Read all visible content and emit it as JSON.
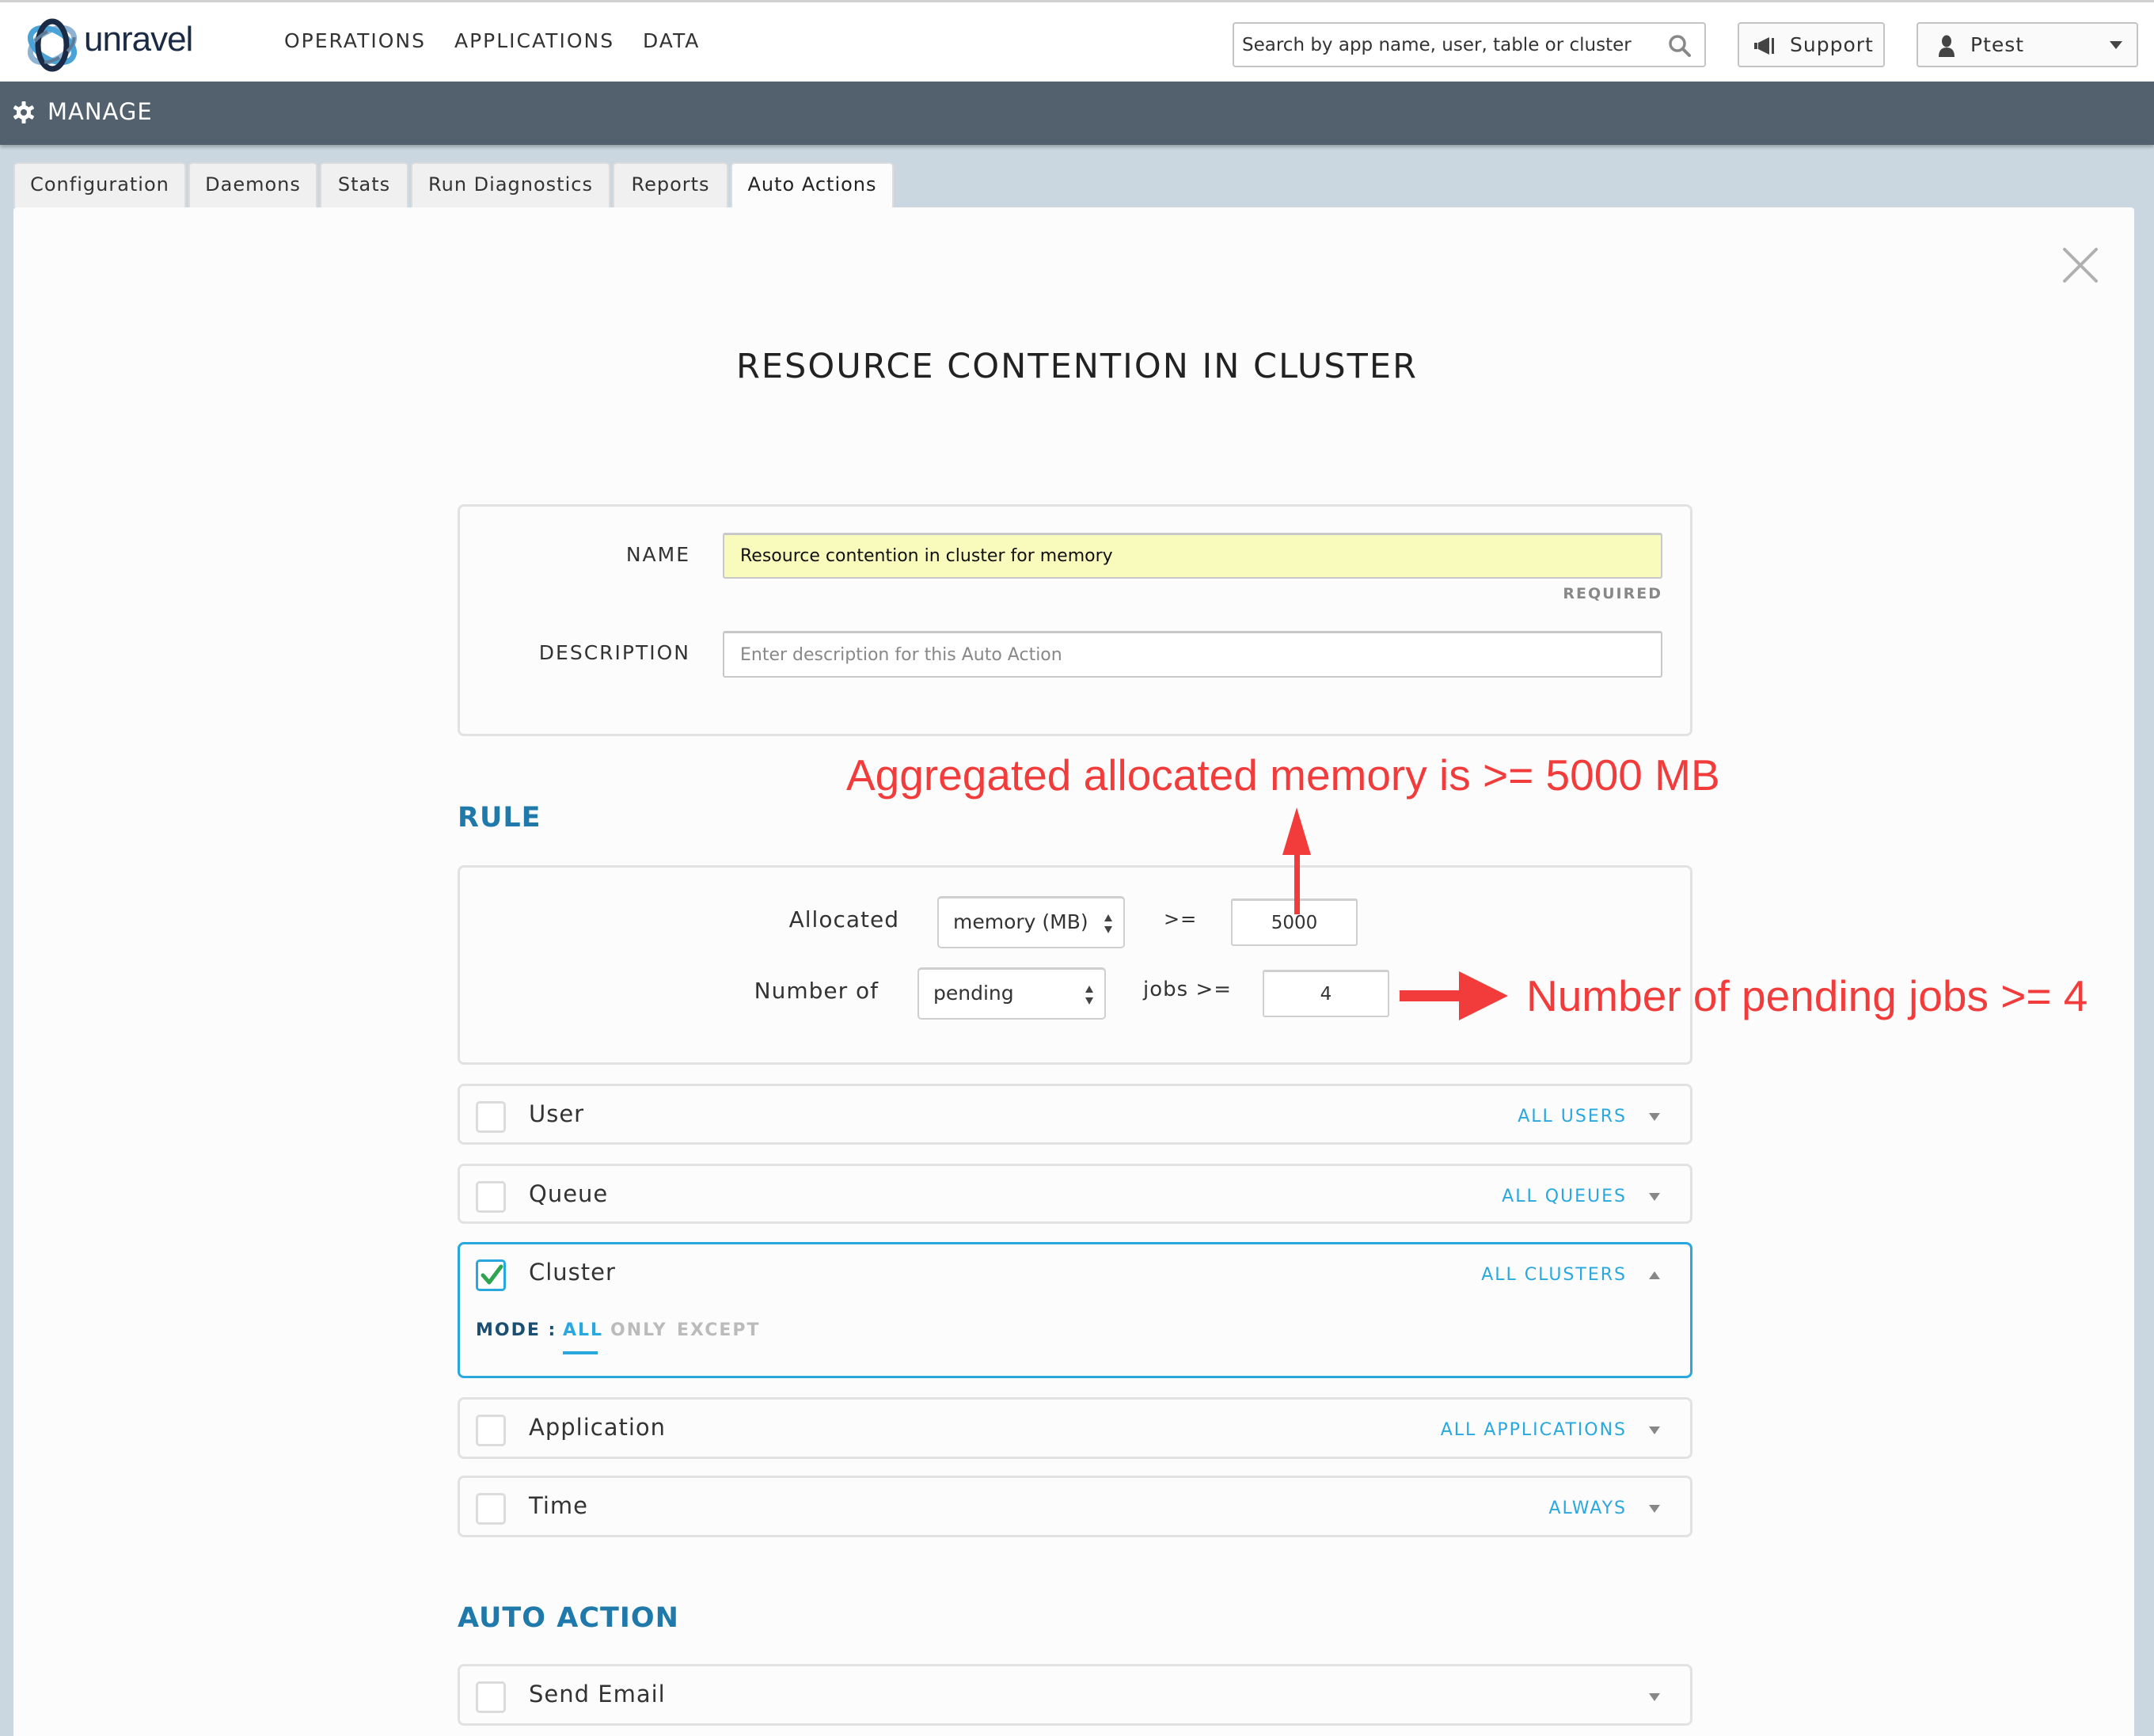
{
  "header": {
    "brand": "unravel",
    "nav": [
      "OPERATIONS",
      "APPLICATIONS",
      "DATA"
    ],
    "search_placeholder": "Search by app name, user, table or cluster",
    "support_label": "Support",
    "user_label": "Ptest",
    "icons": {
      "logo": "unravel-logo",
      "search": "search-icon",
      "support": "megaphone-icon",
      "user": "user-icon",
      "menu": "caret-down-icon"
    }
  },
  "manage_bar": {
    "title": "MANAGE",
    "icon": "gear-icon"
  },
  "tabs": [
    {
      "label": "Configuration",
      "active": false
    },
    {
      "label": "Daemons",
      "active": false
    },
    {
      "label": "Stats",
      "active": false
    },
    {
      "label": "Run Diagnostics",
      "active": false
    },
    {
      "label": "Reports",
      "active": false
    },
    {
      "label": "Auto Actions",
      "active": true
    }
  ],
  "page": {
    "title": "RESOURCE CONTENTION IN CLUSTER",
    "close_icon": "close-icon"
  },
  "form": {
    "name_label": "NAME",
    "name_value": "Resource contention in cluster for memory",
    "required_label": "REQUIRED",
    "description_label": "DESCRIPTION",
    "description_value": "",
    "description_placeholder": "Enter description for this Auto Action"
  },
  "rule": {
    "section_title": "RULE",
    "allocated_label": "Allocated",
    "allocated_select": "memory (MB)",
    "allocated_operator": ">=",
    "allocated_value": "5000",
    "number_label": "Number of",
    "number_select": "pending",
    "jobs_operator": "jobs >=",
    "jobs_value": "4"
  },
  "filters": [
    {
      "label": "User",
      "value": "ALL USERS",
      "checked": false,
      "expanded": false
    },
    {
      "label": "Queue",
      "value": "ALL QUEUES",
      "checked": false,
      "expanded": false
    },
    {
      "label": "Cluster",
      "value": "ALL CLUSTERS",
      "checked": true,
      "expanded": true,
      "mode": {
        "label": "MODE :",
        "options": [
          "ALL",
          "ONLY",
          "EXCEPT"
        ],
        "selected": "ALL"
      }
    },
    {
      "label": "Application",
      "value": "ALL APPLICATIONS",
      "checked": false,
      "expanded": false
    },
    {
      "label": "Time",
      "value": "ALWAYS",
      "checked": false,
      "expanded": false
    }
  ],
  "auto_action": {
    "section_title": "AUTO ACTION",
    "actions": [
      {
        "label": "Send Email",
        "checked": false
      }
    ]
  },
  "annotations": [
    {
      "text": "Aggregated allocated memory is >= 5000 MB",
      "color": "#f23c3c"
    },
    {
      "text": "Number of pending jobs >= 4",
      "color": "#f23c3c"
    }
  ],
  "colors": {
    "accent": "#29a8e0",
    "section_title": "#1f7aab",
    "manage_bar": "#52616d",
    "name_input_bg": "#f9fbbd",
    "annotation": "#f23c3c",
    "check": "#2ea44f"
  }
}
